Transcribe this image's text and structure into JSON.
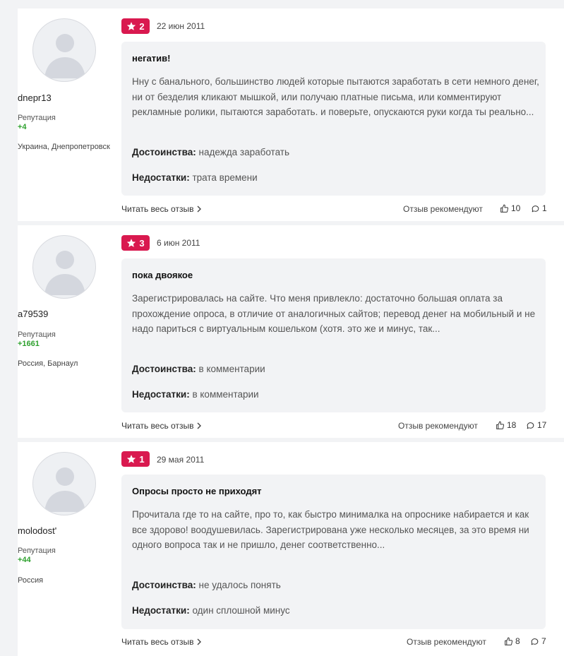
{
  "reviews": [
    {
      "user": {
        "name": "dnepr13",
        "reputation_label": "Репутация",
        "reputation": "+4",
        "location": "Украина, Днепропетровск"
      },
      "rating": "2",
      "date": "22 июн 2011",
      "title": "негатив!",
      "body": "Нну с банального, большинство людей которые пытаются заработать в сети немного денег, ни от безделия кликают мышкой, или получаю платные письма, или комментируют рекламные ролики, пытаются заработать. и поверьте, опускаются руки когда ты реально...",
      "pros_label": "Достоинства:",
      "pros": "надежда заработать",
      "cons_label": "Недостатки:",
      "cons": "трата времени",
      "read_more": "Читать весь отзыв",
      "recommend": "Отзыв рекомендуют",
      "likes": "10",
      "comments": "1"
    },
    {
      "user": {
        "name": "a79539",
        "reputation_label": "Репутация",
        "reputation": "+1661",
        "location": "Россия, Барнаул"
      },
      "rating": "3",
      "date": "6 июн 2011",
      "title": "пока двоякое",
      "body": "Зарегистрировалась на сайте. Что меня привлекло: достаточно большая оплата за прохождение опроса, в отличие от аналогичных сайтов; перевод денег на мобильный и не надо париться с виртуальным кошельком (хотя. это же и минус, так...",
      "pros_label": "Достоинства:",
      "pros": "в комментарии",
      "cons_label": "Недостатки:",
      "cons": "в комментарии",
      "read_more": "Читать весь отзыв",
      "recommend": "Отзыв рекомендуют",
      "likes": "18",
      "comments": "17"
    },
    {
      "user": {
        "name": "molodost'",
        "reputation_label": "Репутация",
        "reputation": "+44",
        "location": "Россия"
      },
      "rating": "1",
      "date": "29 мая 2011",
      "title": "Опросы просто не приходят",
      "body": "Прочитала где то на сайте, про то, как быстро минималка на опроснике набирается и как все здорово! воодушевилась. Зарегистрирована уже несколько месяцев, за это время ни одного вопроса так и не пришло, денег соответственно...",
      "pros_label": "Достоинства:",
      "pros": "не удалось понять",
      "cons_label": "Недостатки:",
      "cons": "один сплошной минус",
      "read_more": "Читать весь отзыв",
      "recommend": "Отзыв рекомендуют",
      "likes": "8",
      "comments": "7"
    }
  ],
  "colors": {
    "badge": "#d9194f",
    "reputation": "#2ea12e",
    "card": "#f2f3f5"
  }
}
